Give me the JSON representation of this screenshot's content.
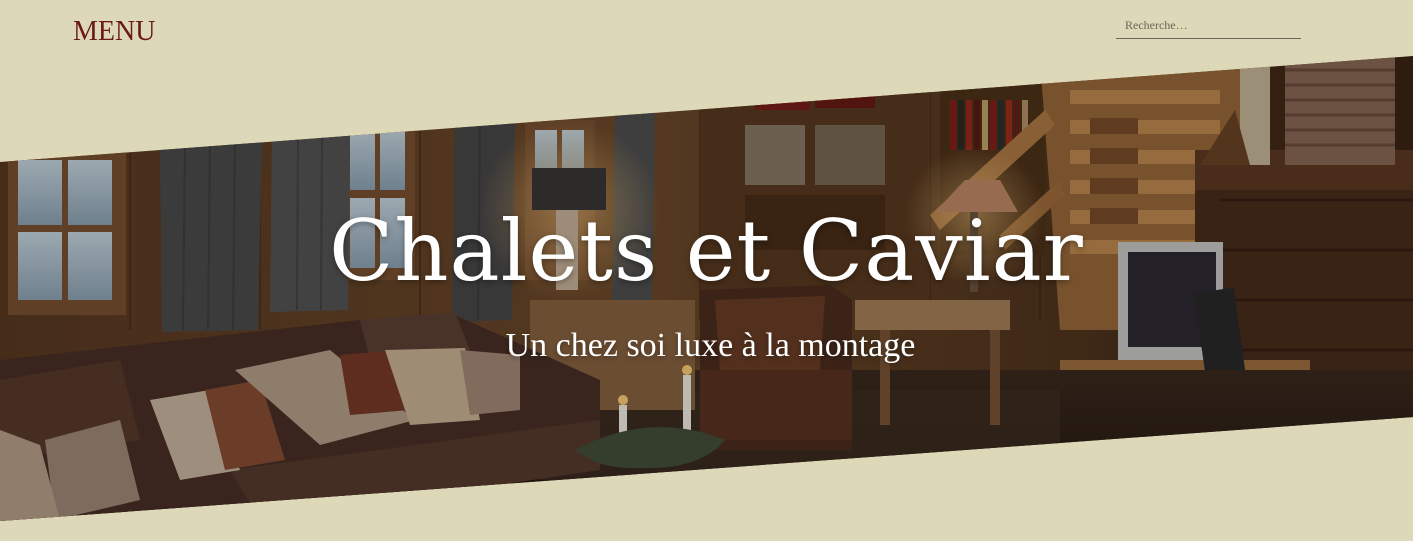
{
  "header": {
    "menu_label": "MENU",
    "search_placeholder": "Recherche…",
    "search_value": ""
  },
  "hero": {
    "title": "Chalets et Caviar",
    "subtitle": "Un chez soi luxe à la montage"
  },
  "colors": {
    "background": "#ddd8b8",
    "menu_text": "#6a1a12",
    "hero_text": "#ffffff"
  }
}
